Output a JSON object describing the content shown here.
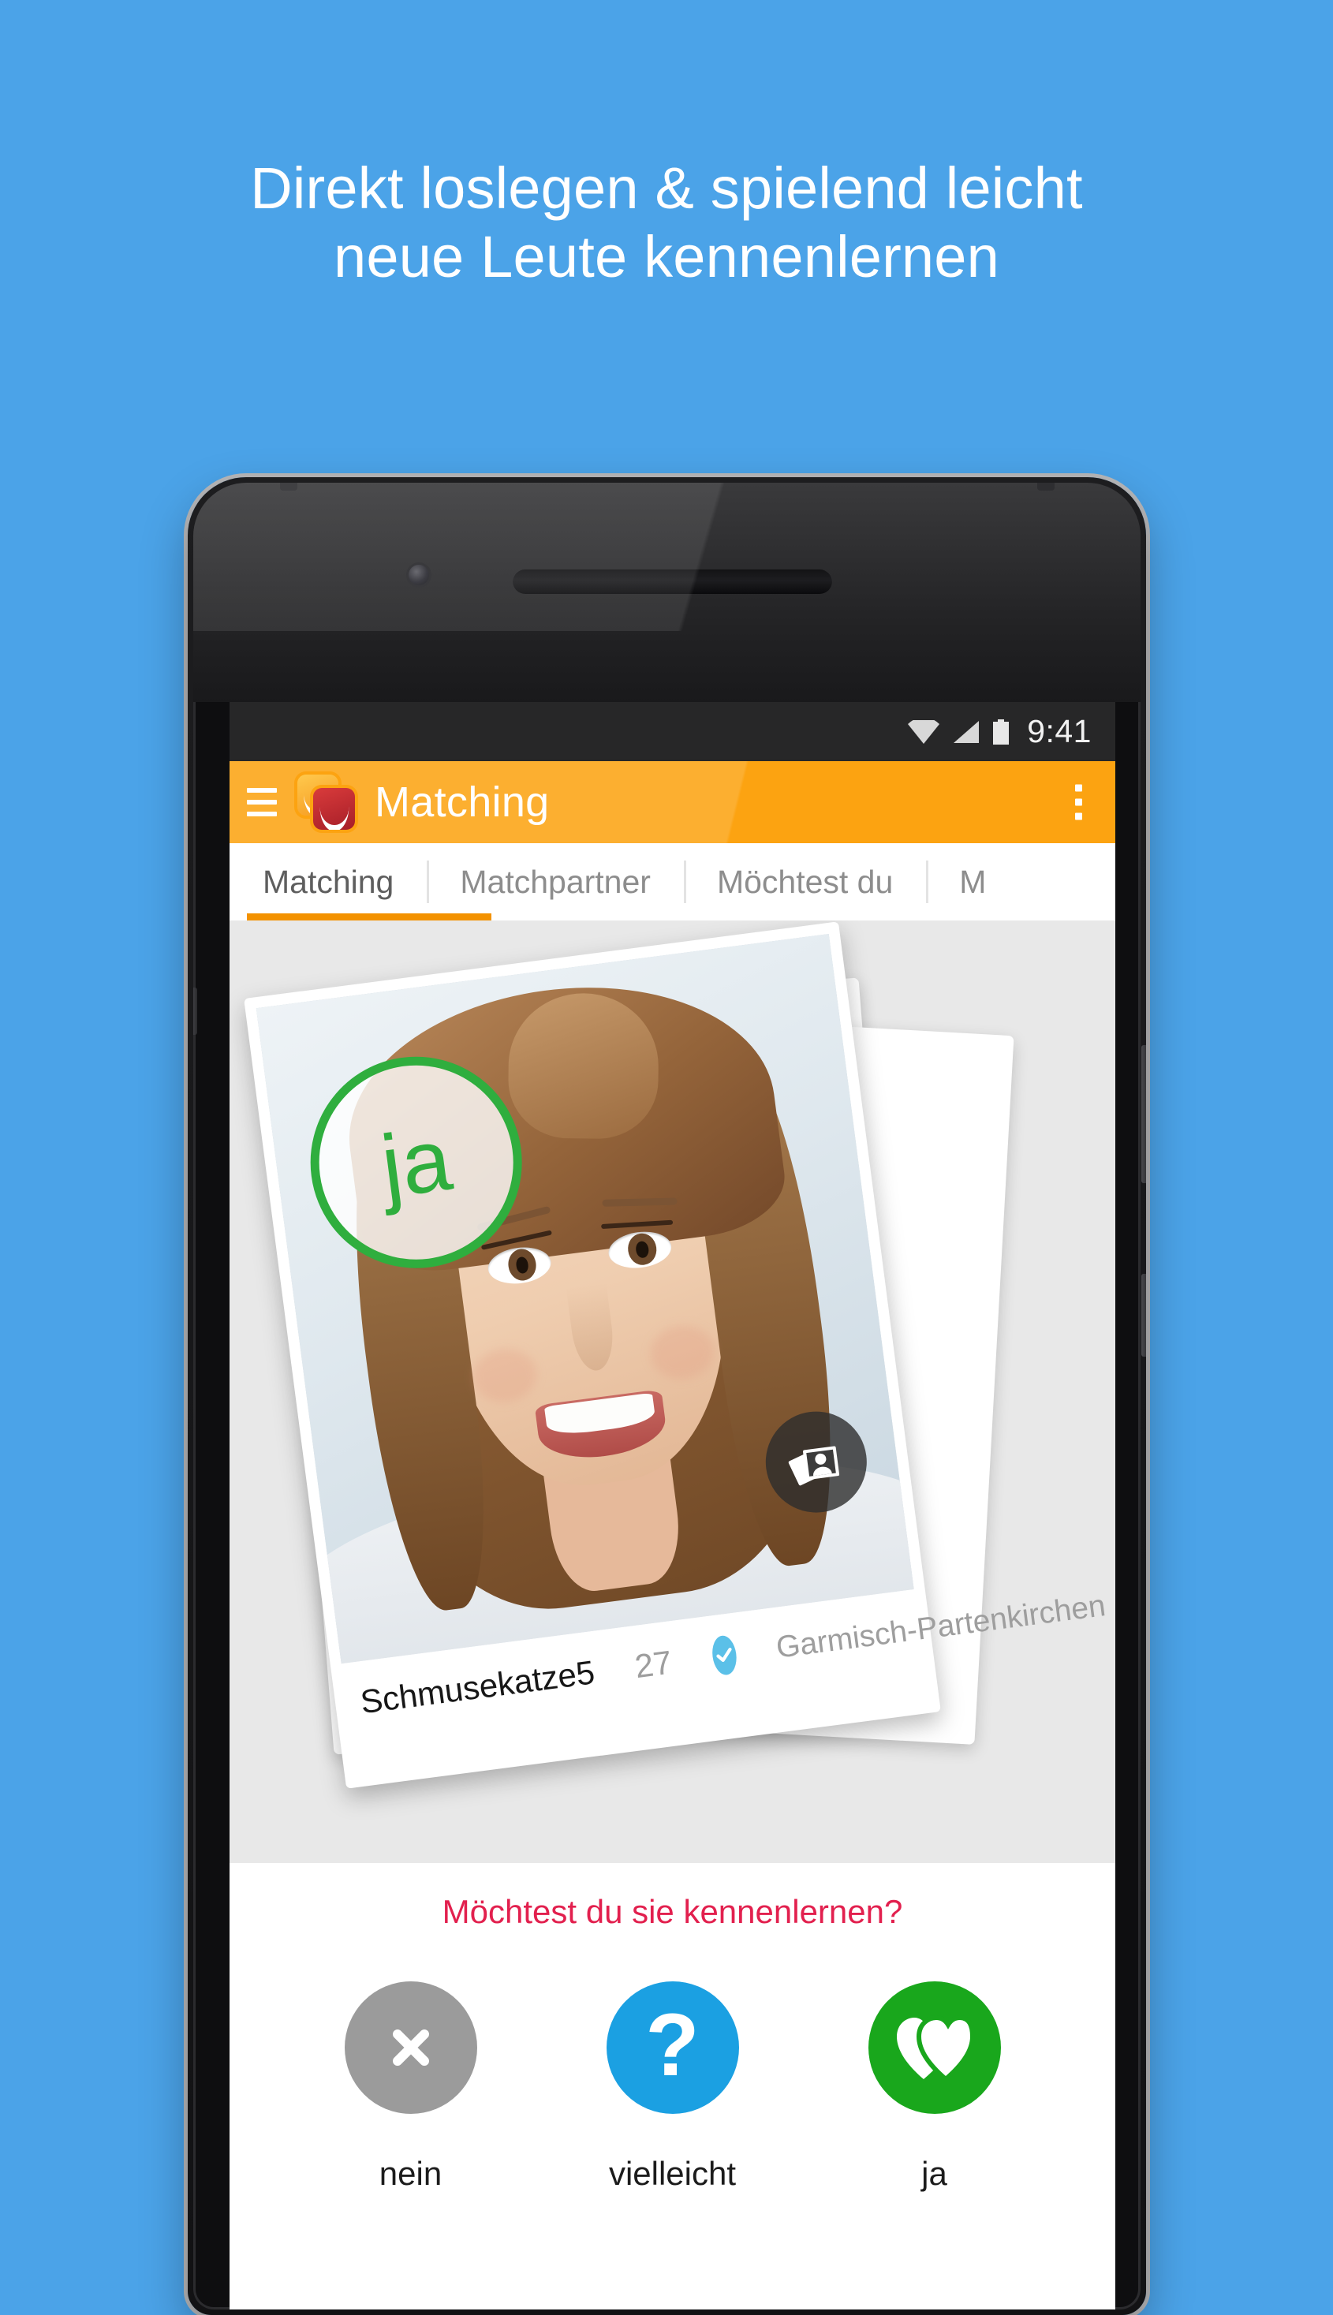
{
  "promo": {
    "headline_line1": "Direkt loslegen & spielend leicht",
    "headline_line2": "neue Leute kennenlernen",
    "background_color": "#4BA3E8",
    "text_color": "#FFFFFF"
  },
  "status_bar": {
    "time": "9:41",
    "icons": [
      "wifi-icon",
      "signal-icon",
      "battery-icon"
    ],
    "background_color": "#272728"
  },
  "app_bar": {
    "menu_icon": "hamburger-menu-icon",
    "logo_icon": "app-logo-icon",
    "title": "Matching",
    "overflow_icon": "overflow-menu-icon",
    "background_color": "#FCA311",
    "title_color": "#FFFFFF"
  },
  "tabs": {
    "active_index": 0,
    "indicator_color": "#F39200",
    "items": [
      {
        "label": "Matching"
      },
      {
        "label": "Matchpartner"
      },
      {
        "label": "Möchtest du"
      },
      {
        "label": "M"
      }
    ]
  },
  "card": {
    "swipe_overlay_label": "ja",
    "swipe_overlay_color": "#2FAE3E",
    "gallery_icon": "photo-gallery-icon",
    "profile": {
      "username": "Schmusekatze5",
      "age": "27",
      "verified_icon": "verified-check-icon",
      "verified_color": "#5BC0E8",
      "city": "Garmisch-Partenkirchen"
    }
  },
  "decision": {
    "question": "Möchtest du sie kennenlernen?",
    "question_color": "#E2204E",
    "buttons": [
      {
        "label": "nein",
        "icon": "close-x-icon",
        "color": "#9B9B9B"
      },
      {
        "label": "vielleicht",
        "icon": "question-mark-icon",
        "color": "#1BA0E2"
      },
      {
        "label": "ja",
        "icon": "double-heart-icon",
        "color": "#19A71C"
      }
    ]
  }
}
